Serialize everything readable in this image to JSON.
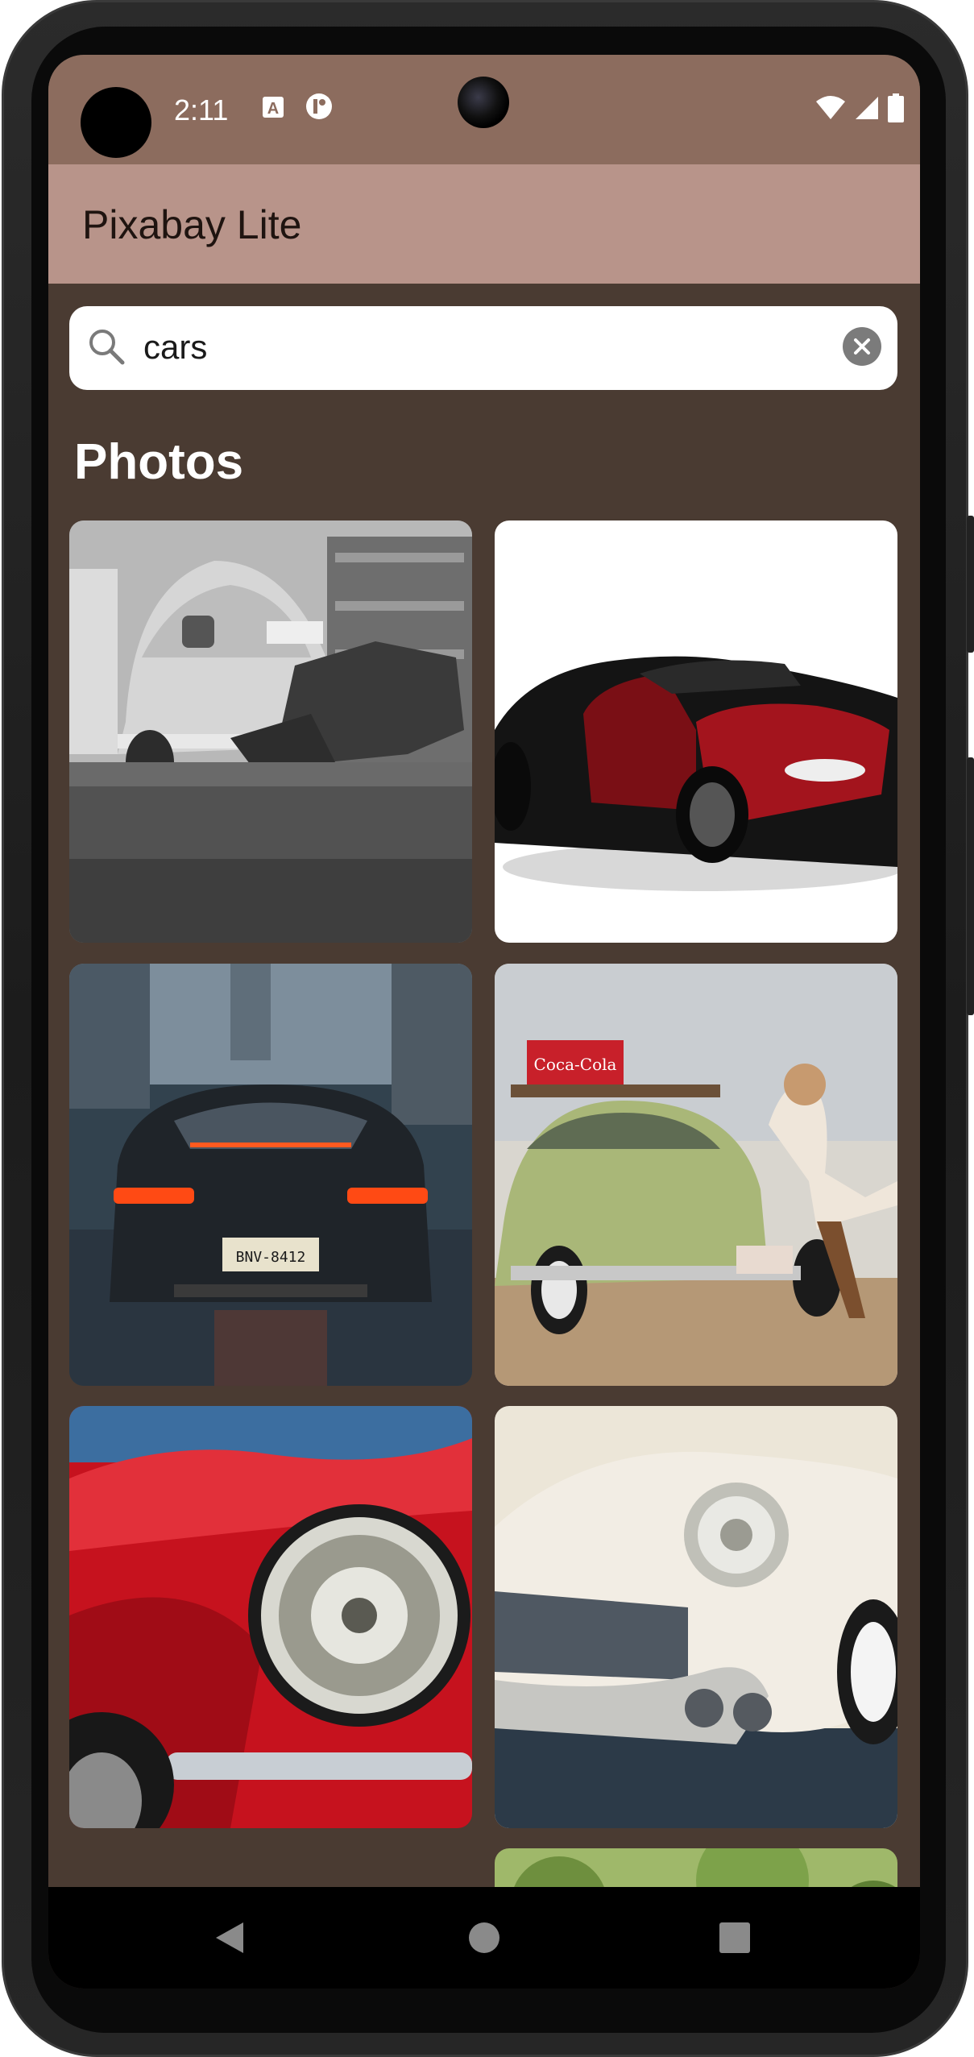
{
  "status_bar": {
    "time": "2:11"
  },
  "app_bar": {
    "title": "Pixabay Lite"
  },
  "search": {
    "value": "cars"
  },
  "section": {
    "title": "Photos"
  },
  "photos": [
    {
      "description": "vintage beetle mechanic black and white"
    },
    {
      "description": "red and black supercar"
    },
    {
      "description": "porsche rear lights city street"
    },
    {
      "description": "green vintage beetle with woman"
    },
    {
      "description": "red classic car headlight"
    },
    {
      "description": "white classic cadillac front chrome"
    },
    {
      "description": "partially visible photo"
    }
  ],
  "colors": {
    "status_bar": "#8c6c5e",
    "app_bar": "#b8948a",
    "background": "#4a3b32"
  }
}
